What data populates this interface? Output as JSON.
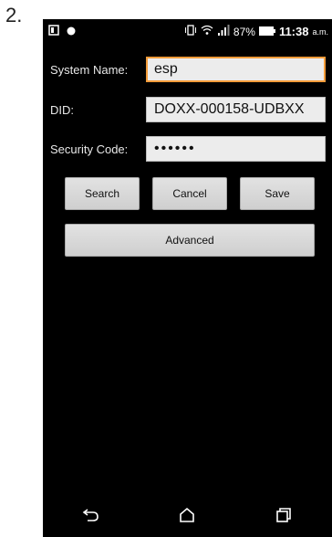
{
  "step_label": "2.",
  "status_bar": {
    "battery_percent": "87%",
    "time": "11:38",
    "ampm": "a.m.",
    "icons": [
      "notification-square-icon",
      "notification-dot-icon",
      "vibrate-icon",
      "wifi-icon",
      "signal-icon",
      "battery-icon"
    ]
  },
  "form": {
    "system_name": {
      "label": "System Name:",
      "value": "esp"
    },
    "did": {
      "label": "DID:",
      "value": "DOXX-000158-UDBXX"
    },
    "security_code": {
      "label": "Security Code:",
      "value": "••••••"
    }
  },
  "buttons": {
    "search": "Search",
    "cancel": "Cancel",
    "save": "Save",
    "advanced": "Advanced"
  },
  "nav_bar": {
    "icons": [
      "back-icon",
      "home-icon",
      "recents-icon"
    ]
  },
  "colors": {
    "screen_background": "#000000",
    "focus_border": "#f39c3a",
    "input_background": "#ececec",
    "button_background": "#d7d7d7"
  }
}
